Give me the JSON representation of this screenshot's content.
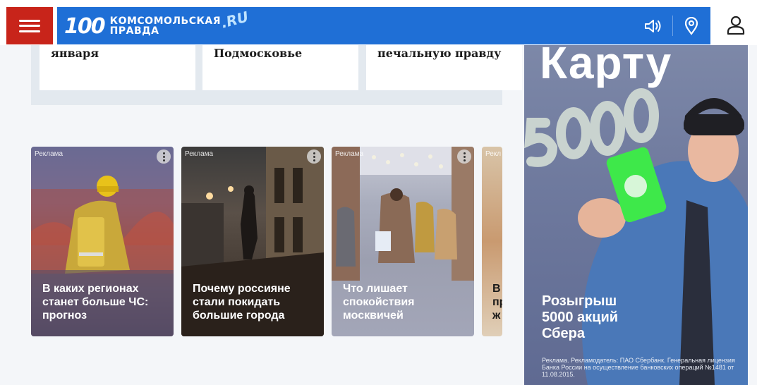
{
  "header": {
    "logo_number": "100",
    "logo_line1": "КОМСОМОЛЬСКАЯ",
    "logo_line2": "ПРАВДА",
    "logo_domain": ".RU",
    "brand_color": "#1f6fd6",
    "menu_color": "#c8241a",
    "icons": [
      "menu-icon",
      "speaker-icon",
      "location-pin-icon",
      "user-icon"
    ]
  },
  "news_cards": [
    {
      "text": "января"
    },
    {
      "text": "Подмосковье"
    },
    {
      "text": "печальную правду"
    }
  ],
  "ad_cards": [
    {
      "label": "Реклама",
      "title": "В каких регионах станет больше ЧС: прогноз"
    },
    {
      "label": "Реклама",
      "title": "Почему россияне стали покидать большие города"
    },
    {
      "label": "Реклама",
      "title": "Что лишает спокойствия москвичей"
    },
    {
      "label": "Рекл",
      "title": "В пр ж"
    }
  ],
  "banner": {
    "headline": "Карту",
    "number": "5000",
    "promo": "Розыгрыш 5000 акций Сбера",
    "legal": "Реклама. Рекламодатель: ПАО Сбербанк. Генеральная лицензия Банка России на осуществление банковских операций №1481 от 11.08.2015."
  }
}
